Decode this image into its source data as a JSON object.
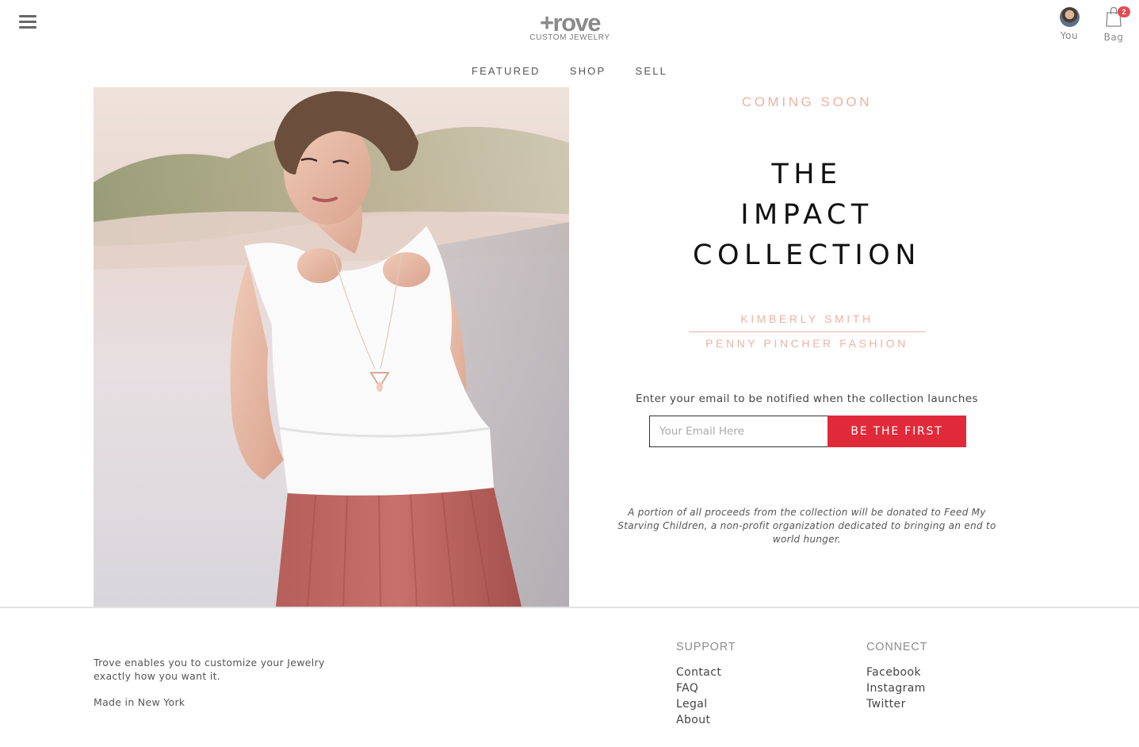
{
  "header": {
    "logo_mark": "+rove",
    "logo_tagline": "CUSTOM JEWELRY",
    "user_label": "You",
    "bag_label": "Bag",
    "bag_count": "2",
    "menu_icon": "hamburger-menu-icon"
  },
  "nav": {
    "items": [
      "FEATURED",
      "SHOP",
      "SELL"
    ]
  },
  "hero": {
    "image_description": "photo-woman-white-top-pink-skirt-pendant-necklace"
  },
  "promo": {
    "eyebrow": "COMING SOON",
    "title_line1": "THE",
    "title_line2": "IMPACT",
    "title_line3": "COLLECTION",
    "designer": "KIMBERLY SMITH",
    "brand": "PENNY PINCHER FASHION",
    "notify_text": "Enter your email to be notified when the collection launches",
    "email_placeholder": "Your Email Here",
    "email_value": "",
    "cta_label": "BE THE FIRST",
    "donation_text": "A portion of all proceeds from the collection will be donated to Feed My Starving Children, a non-profit organization dedicated to bringing an end to world hunger."
  },
  "footer": {
    "about": "Trove enables you to customize your Jewelry exactly how you want it.",
    "made_in": "Made in New York",
    "support": {
      "heading": "SUPPORT",
      "links": [
        "Contact",
        "FAQ",
        "Legal",
        "About"
      ]
    },
    "connect": {
      "heading": "CONNECT",
      "links": [
        "Facebook",
        "Instagram",
        "Twitter"
      ]
    }
  },
  "colors": {
    "accent": "#e02a3a",
    "blush": "#eeb2a2",
    "badge": "#e24c55"
  }
}
